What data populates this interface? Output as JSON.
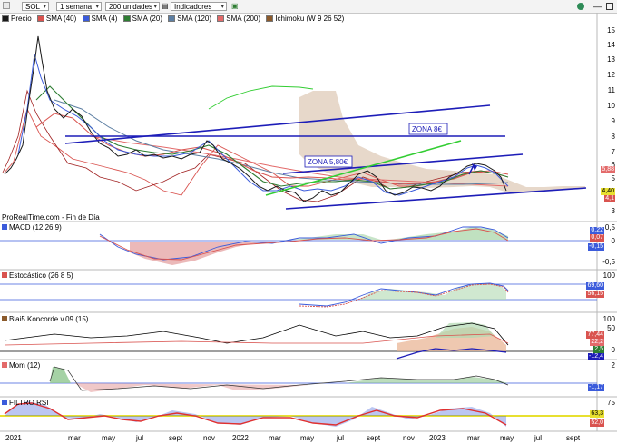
{
  "toolbar": {
    "symbol": "SOL",
    "period": "1 semana",
    "units": "200 unidades",
    "indicators": "Indicadores"
  },
  "legend": [
    {
      "label": "Precio",
      "color": "#1a1a1a"
    },
    {
      "label": "SMA (40)",
      "color": "#d9534f"
    },
    {
      "label": "SMA (4)",
      "color": "#3b5bdb"
    },
    {
      "label": "SMA (20)",
      "color": "#2e7d32"
    },
    {
      "label": "SMA (120)",
      "color": "#5d7fa3"
    },
    {
      "label": "SMA (200)",
      "color": "#e36a6a"
    },
    {
      "label": "Ichimoku (W 9 26 52)",
      "color": "#8b5a2b"
    }
  ],
  "source_note": "ProRealTime.com - Fin de Día",
  "annotations": {
    "zone1": "ZONA 8€",
    "zone2": "ZONA 5,80€"
  },
  "price_axis": [
    "15",
    "14",
    "13",
    "12",
    "11",
    "10",
    "9",
    "8",
    "7",
    "6",
    "5",
    "4",
    "3"
  ],
  "price_tags": {
    "p1": "5,88",
    "p2": "4,40",
    "p3": "4,1"
  },
  "panels": {
    "macd": {
      "title": "MACD (12 26 9)",
      "scale": [
        "0,5",
        "0",
        "-0,5"
      ],
      "tags": [
        "0,22",
        "0,07",
        "-0,15"
      ]
    },
    "stoch": {
      "title": "Estocástico (26 8 5)",
      "scale": [
        "100"
      ],
      "tags": [
        "69,60",
        "56,15"
      ]
    },
    "koncorde": {
      "title": "Blai5 Koncorde v.09 (15)",
      "scale": [
        "100",
        "50",
        "0"
      ],
      "tags": [
        "77,44",
        "22,2",
        "2,5",
        "-12,4"
      ]
    },
    "mom": {
      "title": "Mom (12)",
      "scale": [
        "2"
      ],
      "tags": [
        "-1,17"
      ]
    },
    "rsi": {
      "title": "FILTRO RSI",
      "scale": [
        "75"
      ],
      "tags": [
        "63,3",
        "52,0"
      ]
    }
  },
  "x_axis": [
    "2021",
    "mar",
    "may",
    "jul",
    "sept",
    "nov",
    "2022",
    "mar",
    "may",
    "jul",
    "sept",
    "nov",
    "2023",
    "mar",
    "may",
    "jul",
    "sept"
  ],
  "chart_data": {
    "type": "line",
    "title": "",
    "x": [
      "2021",
      "mar",
      "may",
      "jul",
      "sept",
      "nov",
      "2022",
      "mar",
      "may",
      "jul",
      "sept",
      "nov",
      "2023",
      "mar",
      "may"
    ],
    "series": [
      {
        "name": "Precio",
        "values": [
          4.5,
          13.8,
          9.5,
          7.2,
          6.8,
          7.0,
          6.9,
          5.9,
          3.8,
          4.9,
          5.1,
          4.0,
          5.0,
          5.9,
          4.4
        ]
      }
    ],
    "ylim": [
      3,
      15
    ],
    "ylabel": "",
    "xlabel": ""
  }
}
